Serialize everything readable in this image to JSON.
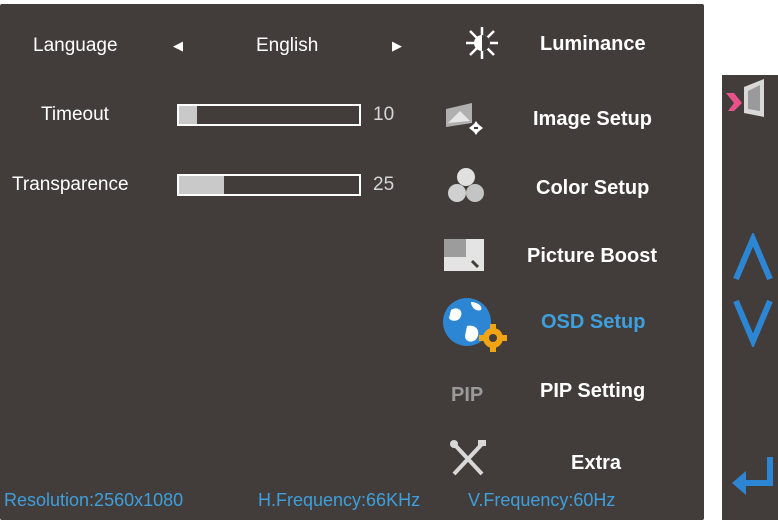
{
  "settings": {
    "language": {
      "label": "Language",
      "value": "English"
    },
    "timeout": {
      "label": "Timeout",
      "value": 10,
      "fill": 0.1
    },
    "transparence": {
      "label": "Transparence",
      "value": 25,
      "fill": 0.25
    }
  },
  "menu": {
    "items": [
      {
        "label": "Luminance",
        "icon": "luminance-icon"
      },
      {
        "label": "Image Setup",
        "icon": "image-setup-icon"
      },
      {
        "label": "Color Setup",
        "icon": "color-setup-icon"
      },
      {
        "label": "Picture Boost",
        "icon": "picture-boost-icon"
      },
      {
        "label": "OSD Setup",
        "icon": "osd-setup-icon",
        "active": true
      },
      {
        "label": "PIP Setting",
        "icon": "pip-icon",
        "icon_text": "PIP"
      },
      {
        "label": "Extra",
        "icon": "extra-tools-icon"
      }
    ]
  },
  "status": {
    "resolution": "Resolution:2560x1080",
    "h_frequency": "H.Frequency:66KHz",
    "v_frequency": "V.Frequency:60Hz"
  },
  "colors": {
    "panel_bg": "#423d3a",
    "accent": "#3e9fdc",
    "text": "#ffffff",
    "slider_fill": "#c9c9c9"
  }
}
